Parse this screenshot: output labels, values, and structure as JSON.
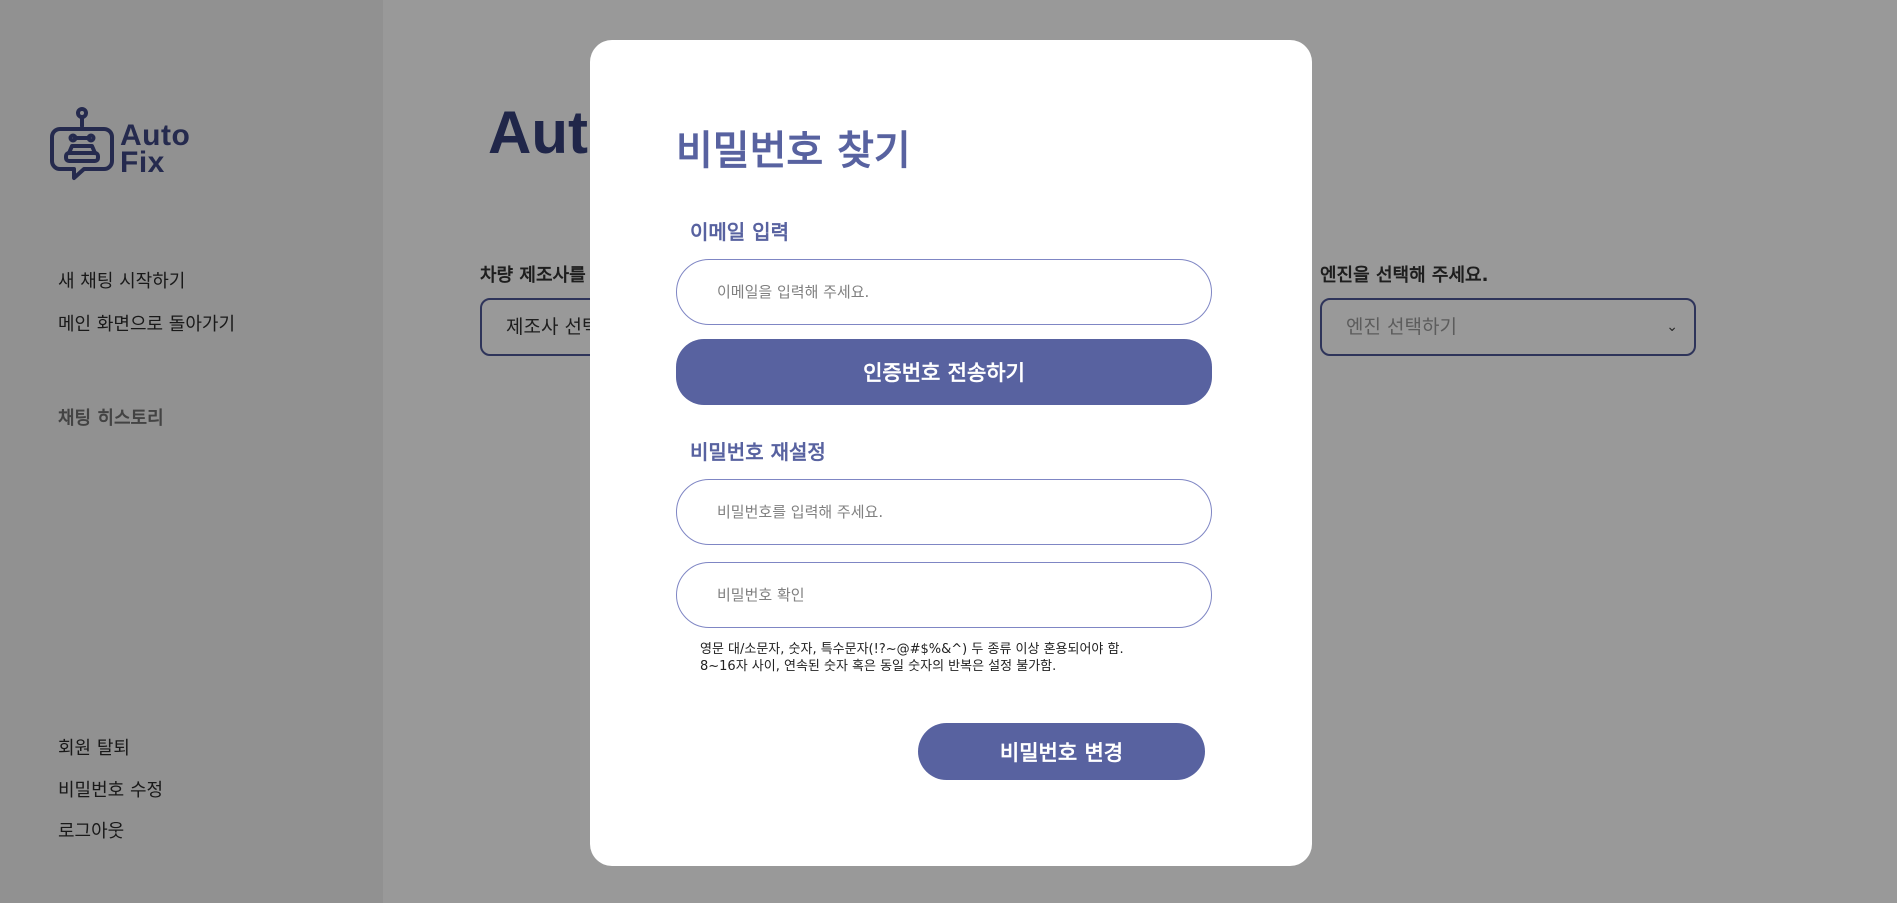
{
  "brand": {
    "logo_line1": "Auto",
    "logo_line2": "Fix"
  },
  "sidebar": {
    "new_chat": "새 채팅 시작하기",
    "back_home": "메인 화면으로 돌아가기",
    "history_title": "채팅 히스토리",
    "withdraw": "회원 탈퇴",
    "change_password": "비밀번호 수정",
    "logout": "로그아웃"
  },
  "main": {
    "title": "Auto",
    "maker_label": "차량 제조사를",
    "maker_select": "제조사 선택",
    "engine_label": "엔진을 선택해 주세요.",
    "engine_select": "엔진 선택하기"
  },
  "modal": {
    "title": "비밀번호 찾기",
    "email_label": "이메일 입력",
    "email_placeholder": "이메일을 입력해 주세요.",
    "send_code_button": "인증번호 전송하기",
    "reset_label": "비밀번호 재설정",
    "password_placeholder": "비밀번호를 입력해 주세요.",
    "confirm_placeholder": "비밀번호 확인",
    "rule_line1": "영문 대/소문자, 숫자, 특수문자(!?~@#$%&^) 두 종류 이상 혼용되어야 함.",
    "rule_line2": "8~16자 사이, 연속된 숫자 혹은 동일 숫자의 반복은 설정 불가함.",
    "submit_button": "비밀번호 변경"
  },
  "colors": {
    "accent": "#5862a0",
    "brand_dark": "#3e4783",
    "sidebar_bg": "#f2f2f2",
    "overlay": "rgba(0,0,0,0.4)"
  }
}
